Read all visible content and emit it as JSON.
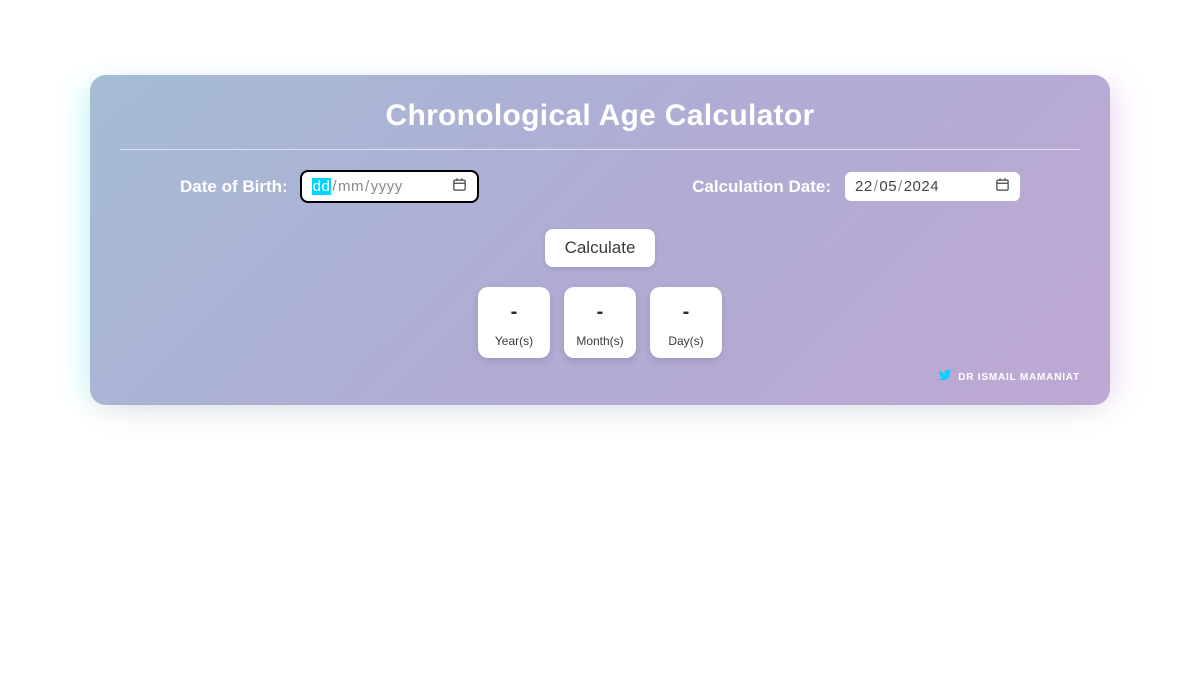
{
  "title": "Chronological Age Calculator",
  "inputs": {
    "dob": {
      "label": "Date of Birth:",
      "day": "dd",
      "month": "mm",
      "year": "yyyy"
    },
    "calc_date": {
      "label": "Calculation Date:",
      "day": "22",
      "month": "05",
      "year": "2024"
    }
  },
  "calculate_button": "Calculate",
  "results": {
    "years": {
      "value": "-",
      "label": "Year(s)"
    },
    "months": {
      "value": "-",
      "label": "Month(s)"
    },
    "days": {
      "value": "-",
      "label": "Day(s)"
    }
  },
  "footer": {
    "author": "DR ISMAIL MAMANIAT"
  }
}
